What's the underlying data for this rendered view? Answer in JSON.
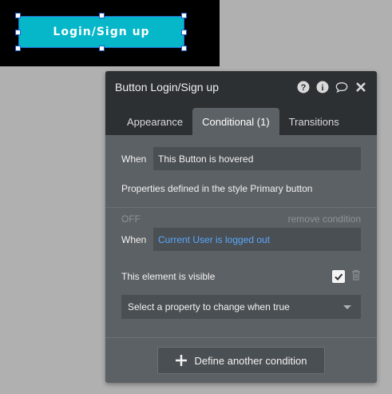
{
  "canvas": {
    "button_label": "Login/Sign up",
    "button_color": "#05b7c8"
  },
  "panel": {
    "title": "Button Login/Sign up",
    "header_icons": [
      "help-icon",
      "info-icon",
      "comment-icon",
      "close-icon"
    ],
    "tabs": [
      {
        "label": "Appearance",
        "active": false
      },
      {
        "label": "Conditional (1)",
        "active": true
      },
      {
        "label": "Transitions",
        "active": false
      }
    ],
    "condition1": {
      "when_label": "When",
      "when_value": "This Button is hovered",
      "style_note": "Properties defined in the style Primary button"
    },
    "condition2": {
      "status": "OFF",
      "remove_label": "remove condition",
      "when_label": "When",
      "when_value": "Current User is logged out",
      "when_value_color": "#5aa8ff",
      "property_label": "This element is visible",
      "property_checked": true,
      "select_placeholder": "Select a property to change when true"
    },
    "add_button_label": "Define another condition"
  }
}
